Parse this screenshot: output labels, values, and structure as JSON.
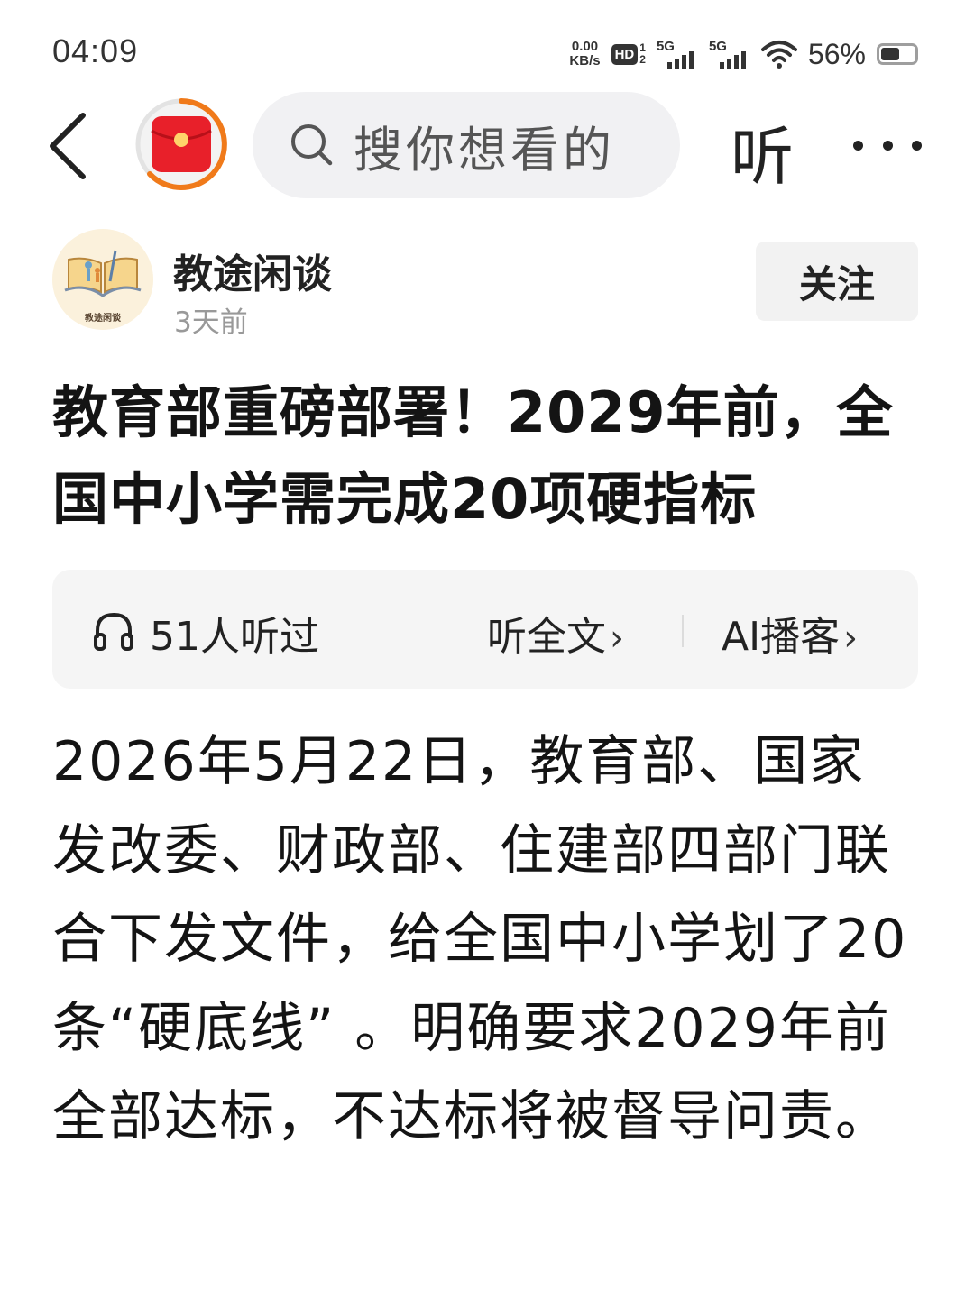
{
  "status_bar": {
    "time": "04:09",
    "net_speed_value": "0.00",
    "net_speed_unit": "KB/s",
    "hd_label": "HD",
    "hd_sub_top": "1",
    "hd_sub_bottom": "2",
    "signal1_label": "5G",
    "signal2_label": "5G",
    "battery_percent": "56%",
    "battery_level": 0.56
  },
  "nav": {
    "search_placeholder": "搜你想看的",
    "listen_label": "听"
  },
  "author": {
    "name": "教途闲谈",
    "avatar_caption": "教途闲谈",
    "post_time": "3天前",
    "follow_label": "关注"
  },
  "article": {
    "title": "教育部重磅部署！2029年前，全国中小学需完成20项硬指标",
    "body": "2026年5月22日，教育部、国家发改委、财政部、住建部四部门联合下发文件，给全国中小学划了20条“硬底线” 。明确要求2029年前全部达标，不达标将被督导问责。"
  },
  "audio": {
    "listeners_label": "51人听过",
    "listen_full_label": "听全文",
    "ai_podcast_label": "AI播客",
    "chevron": "›"
  },
  "colors": {
    "redpacket_red": "#e8202a",
    "redpacket_ring": "#f07a1a",
    "search_bg": "#f1f1f3",
    "follow_bg": "#f2f2f2",
    "audio_bg": "#f5f5f5"
  }
}
